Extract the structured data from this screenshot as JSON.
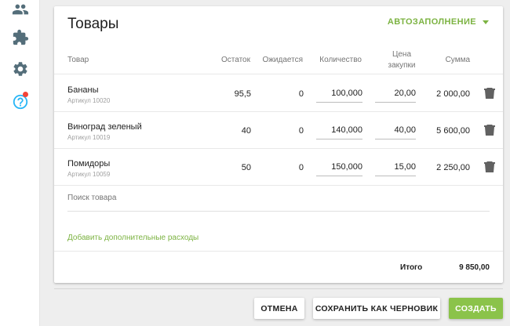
{
  "sidebar": {
    "icons": [
      "people-icon",
      "puzzle-icon",
      "gear-icon",
      "help-icon"
    ],
    "icon_color": "#546e7a",
    "help_color": "#29b6f6",
    "badge_color": "#f44336"
  },
  "card": {
    "title": "Товары",
    "autofill_label": "АВТОЗАПОЛНЕНИЕ"
  },
  "table": {
    "headers": {
      "product": "Товар",
      "stock": "Остаток",
      "expected": "Ожидается",
      "quantity": "Количество",
      "price_line1": "Цена",
      "price_line2": "закупки",
      "sum": "Сумма"
    },
    "rows": [
      {
        "name": "Бананы",
        "sku": "Артикул 10020",
        "stock": "95,5",
        "expected": "0",
        "quantity": "100,000",
        "price": "20,00",
        "sum": "2 000,00"
      },
      {
        "name": "Виноград зеленый",
        "sku": "Артикул 10019",
        "stock": "40",
        "expected": "0",
        "quantity": "140,000",
        "price": "40,00",
        "sum": "5 600,00"
      },
      {
        "name": "Помидоры",
        "sku": "Артикул 10059",
        "stock": "50",
        "expected": "0",
        "quantity": "150,000",
        "price": "15,00",
        "sum": "2 250,00"
      }
    ]
  },
  "search": {
    "placeholder": "Поиск товара"
  },
  "add_costs_label": "Добавить дополнительные расходы",
  "total": {
    "label": "Итого",
    "value": "9 850,00"
  },
  "buttons": {
    "cancel": "ОТМЕНА",
    "save_draft": "СОХРАНИТЬ КАК ЧЕРНОВИК",
    "create": "СОЗДАТЬ"
  },
  "colors": {
    "accent": "#7cb342",
    "primary_button": "#8bc34a"
  }
}
